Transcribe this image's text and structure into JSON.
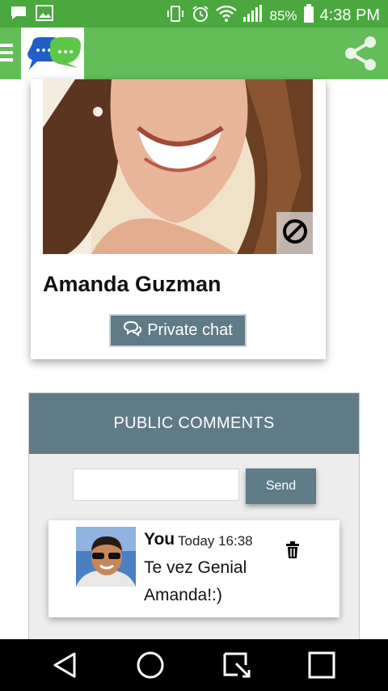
{
  "status_bar": {
    "battery": "85%",
    "time": "4:38 PM"
  },
  "colors": {
    "status_bar": "#4aa83f",
    "app_bar": "#63bd59",
    "accent": "#5f7b88",
    "logo_blue": "#1f5fc7",
    "logo_green": "#5cc84a"
  },
  "app_bar": {
    "icons": [
      "menu-icon",
      "app-logo",
      "share-icon"
    ]
  },
  "profile": {
    "name": "Amanda Guzman",
    "private_chat_label": "Private chat",
    "block_icon": "block-icon"
  },
  "comments": {
    "header": "PUBLIC COMMENTS",
    "input_value": "",
    "send_label": "Send",
    "items": [
      {
        "author": "You",
        "time": "Today 16:38",
        "text": "Te vez Genial Amanda!:)",
        "icon": "trash-icon"
      }
    ]
  },
  "nav_bar": {
    "icons": [
      "back-icon",
      "home-icon",
      "recents-icon",
      "overview-icon"
    ]
  }
}
